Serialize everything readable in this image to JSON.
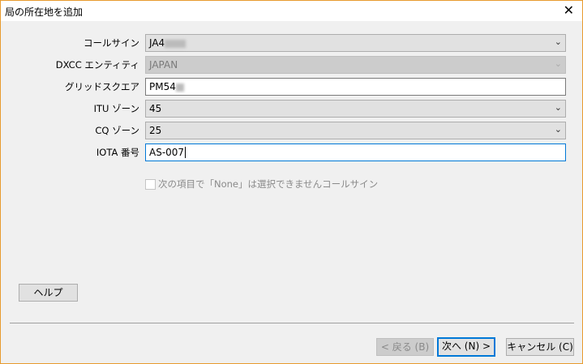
{
  "window": {
    "title": "局の所在地を追加",
    "close": "✕"
  },
  "form": {
    "callsign": {
      "label": "コールサイン",
      "value": "JA4"
    },
    "dxcc": {
      "label": "DXCC エンティティ",
      "value": "JAPAN"
    },
    "grid": {
      "label": "グリッドスクエア",
      "value": "PM54"
    },
    "itu": {
      "label": "ITU ゾーン",
      "value": "45"
    },
    "cq": {
      "label": "CQ ゾーン",
      "value": "25"
    },
    "iota": {
      "label": "IOTA 番号",
      "value": "AS-007"
    },
    "checkbox": {
      "label": "次の項目で「None」は選択できませんコールサイン",
      "checked": false
    }
  },
  "buttons": {
    "help": "ヘルプ",
    "back": "< 戻る (B)",
    "next": "次へ (N) >",
    "cancel": "キャンセル (C)"
  },
  "colors": {
    "border": "#e89b2e",
    "focus": "#0078d7"
  }
}
